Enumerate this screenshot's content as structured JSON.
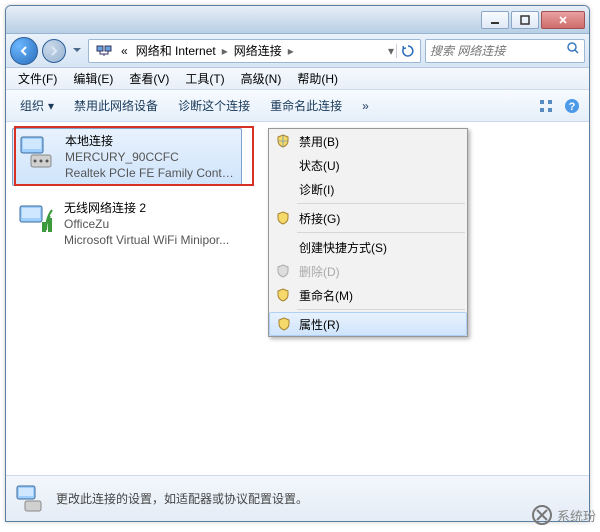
{
  "titlebar": {
    "minimize": "—",
    "maximize": "▢",
    "close": "✕"
  },
  "path": {
    "prefix": "«",
    "seg1": "网络和 Internet",
    "seg2": "网络连接"
  },
  "search": {
    "placeholder": "搜索 网络连接"
  },
  "menubar": {
    "file": "文件(F)",
    "edit": "编辑(E)",
    "view": "查看(V)",
    "tools": "工具(T)",
    "advanced": "高级(N)",
    "help": "帮助(H)"
  },
  "toolbar": {
    "organize": "组织",
    "disable_device": "禁用此网络设备",
    "diagnose": "诊断这个连接",
    "rename": "重命名此连接"
  },
  "connections": [
    {
      "name": "本地连接",
      "status": "MERCURY_90CCFC",
      "device": "Realtek PCIe FE Family Control..."
    },
    {
      "name": "无线网络连接 2",
      "status": "OfficeZu",
      "device": "Microsoft Virtual WiFi Minipor..."
    }
  ],
  "context_menu": {
    "disable": "禁用(B)",
    "status": "状态(U)",
    "diagnose": "诊断(I)",
    "bridge": "桥接(G)",
    "shortcut": "创建快捷方式(S)",
    "delete": "删除(D)",
    "rename": "重命名(M)",
    "properties": "属性(R)"
  },
  "tooltip_overlays": {
    "status1": "状态",
    "status2": "状态",
    "diagnose1": "诊断(I)",
    "diagnose2": "桥接",
    "bridge1": "创建快捷方",
    "bridge2": "建快捷"
  },
  "statusbar": {
    "text": "更改此连接的设置，如适配器或协议配置设置。"
  },
  "watermark": {
    "text": "系统玢"
  }
}
